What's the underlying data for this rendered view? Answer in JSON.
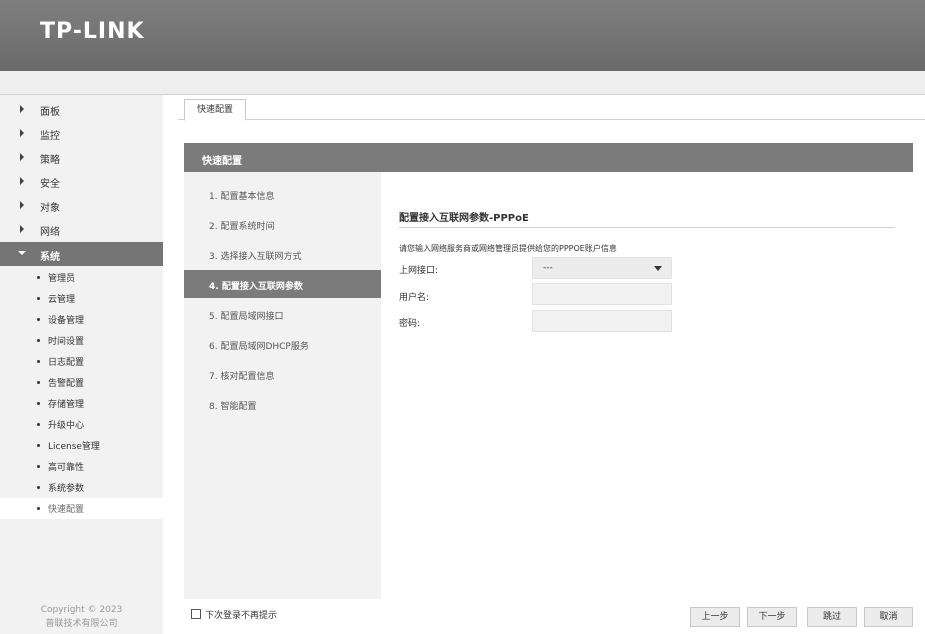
{
  "brand": {
    "logo": "TP-LINK"
  },
  "sidebar": {
    "items": [
      {
        "label": "面板"
      },
      {
        "label": "监控"
      },
      {
        "label": "策略"
      },
      {
        "label": "安全"
      },
      {
        "label": "对象"
      },
      {
        "label": "网络"
      },
      {
        "label": "系统"
      }
    ],
    "subitems": [
      {
        "label": "管理员"
      },
      {
        "label": "云管理"
      },
      {
        "label": "设备管理"
      },
      {
        "label": "时间设置"
      },
      {
        "label": "日志配置"
      },
      {
        "label": "告警配置"
      },
      {
        "label": "存储管理"
      },
      {
        "label": "升级中心"
      },
      {
        "label": "License管理"
      },
      {
        "label": "高可靠性"
      },
      {
        "label": "系统参数"
      },
      {
        "label": "快速配置"
      }
    ],
    "copyright_line1": "Copyright © 2023",
    "copyright_line2": "普联技术有限公司"
  },
  "tabs": [
    {
      "label": "快速配置"
    }
  ],
  "panel": {
    "title": "快速配置"
  },
  "steps": [
    {
      "label": "1. 配置基本信息"
    },
    {
      "label": "2. 配置系统时间"
    },
    {
      "label": "3. 选择接入互联网方式"
    },
    {
      "label": "4. 配置接入互联网参数"
    },
    {
      "label": "5. 配置局域网接口"
    },
    {
      "label": "6. 配置局域网DHCP服务"
    },
    {
      "label": "7. 核对配置信息"
    },
    {
      "label": "8. 智能配置"
    }
  ],
  "form": {
    "title": "配置接入互联网参数-PPPoE",
    "description": "请您输入网络服务商或网络管理员提供给您的PPPOE账户信息",
    "uplink_label": "上网接口:",
    "uplink_value": "---",
    "username_label": "用户名:",
    "username_value": "",
    "password_label": "密码:",
    "password_value": ""
  },
  "footer": {
    "checkbox_label": "下次登录不再提示",
    "prev_label": "上一步",
    "next_label": "下一步",
    "skip_label": "跳过",
    "cancel_label": "取消"
  }
}
